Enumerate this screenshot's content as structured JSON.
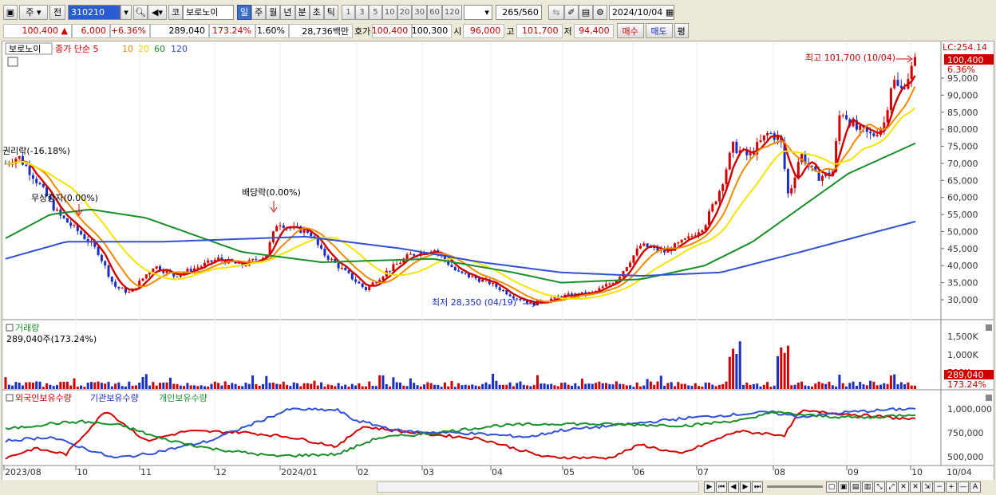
{
  "toolbar": {
    "mode_label": "주",
    "prev_label": "전",
    "code_value": "310210",
    "stock_prefix": "코",
    "stock_name": "보로노이",
    "periods": [
      "일",
      "주",
      "월",
      "년",
      "분",
      "초",
      "틱"
    ],
    "active_period": "일",
    "minutes": [
      "1",
      "3",
      "5",
      "10",
      "20",
      "30",
      "60",
      "120"
    ],
    "count_value": "265",
    "count_total": "/560",
    "date_value": "2024/10/04"
  },
  "quote": {
    "price": "100,400",
    "arrow": "▲",
    "change": "6,000",
    "pct": "+6.36%",
    "volume": "289,040",
    "vol_pct": "173.24%",
    "turnover": "1.60%",
    "amount": "28,736백만",
    "hoga_label": "호가",
    "ask": "100,400",
    "bid": "100,300",
    "open_label": "시",
    "open": "96,000",
    "high_label": "고",
    "high": "101,700",
    "low_label": "저",
    "low": "94,400",
    "buy_label": "매수",
    "sell_label": "매도",
    "avg_label": "평"
  },
  "price_panel": {
    "name": "보로노이",
    "legend_prefix": "종가 단순 5",
    "ma": [
      {
        "label": "5",
        "color": "#d00000"
      },
      {
        "label": "10",
        "color": "#f08a00"
      },
      {
        "label": "20",
        "color": "#e8d800"
      },
      {
        "label": "60",
        "color": "#18902a"
      },
      {
        "label": "120",
        "color": "#3050d8"
      }
    ],
    "lc_label": "LC:254.14",
    "current_price": "100,400",
    "current_pct": "6.36%",
    "high_note": "최고 101,700 (10/04)",
    "low_note": "최저 28,350 (04/19)",
    "event1": "권리락(-16.18%)",
    "event2": "무상증자(0.00%)",
    "event3": "배당락(0.00%)",
    "y_ticks": [
      "95,000",
      "90,000",
      "85,000",
      "80,000",
      "75,000",
      "70,000",
      "65,000",
      "60,000",
      "55,000",
      "50,000",
      "45,000",
      "40,000",
      "35,000",
      "30,000"
    ]
  },
  "volume_panel": {
    "title": "거래량",
    "value": "289,040주(173.24%)",
    "y_ticks": [
      "1,500K",
      "1,000K",
      "500K"
    ],
    "current": "289,040",
    "current_pct": "173.24%"
  },
  "holder_panel": {
    "foreign": "외국인보유수량",
    "inst": "기관보유수량",
    "indiv": "개인보유수량",
    "y_ticks": [
      "1,000,000",
      "750,000",
      "500,000"
    ]
  },
  "x_axis": [
    "2023/08",
    "10",
    "11",
    "12",
    "2024/01",
    "02",
    "03",
    "04",
    "05",
    "06",
    "07",
    "08",
    "09",
    "10",
    "10/04"
  ],
  "colors": {
    "up": "#d00000",
    "down": "#1a2fc0",
    "accent": "#3e6fc8"
  }
}
